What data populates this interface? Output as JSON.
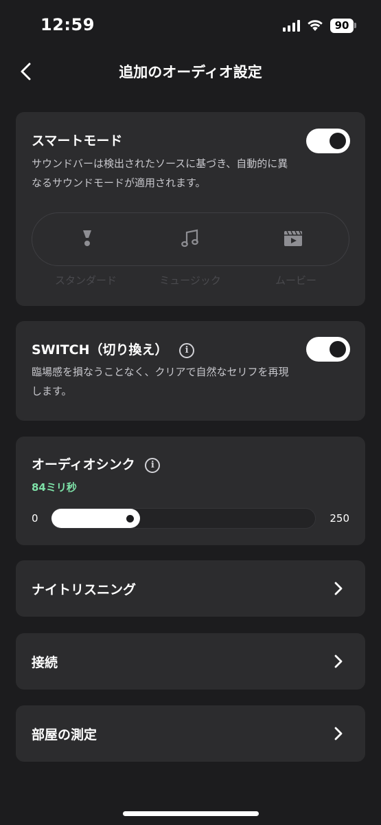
{
  "status_bar": {
    "time": "12:59",
    "battery": "90"
  },
  "header": {
    "title": "追加のオーディオ設定"
  },
  "smart_mode": {
    "title": "スマートモード",
    "description": "サウンドバーは検出されたソースに基づき、自動的に異なるサウンドモードが適用されます。",
    "enabled": true,
    "modes": [
      {
        "label": "スタンダード",
        "icon": "standard-mode-icon"
      },
      {
        "label": "ミュージック",
        "icon": "music-note-icon"
      },
      {
        "label": "ムービー",
        "icon": "movie-clapper-icon"
      }
    ]
  },
  "switch_card": {
    "title": "SWITCH（切り換え）",
    "description": "臨場感を損なうことなく、クリアで自然なセリフを再現します。",
    "enabled": true
  },
  "audio_sync": {
    "title": "オーディオシンク",
    "value_label": "84ミリ秒",
    "min": "0",
    "max": "250",
    "value": 84
  },
  "rows": [
    {
      "label": "ナイトリスニング"
    },
    {
      "label": "接続"
    },
    {
      "label": "部屋の測定"
    }
  ],
  "colors": {
    "background": "#1c1c1e",
    "card": "#2c2c2e",
    "accent_green": "#7ee2a8"
  }
}
